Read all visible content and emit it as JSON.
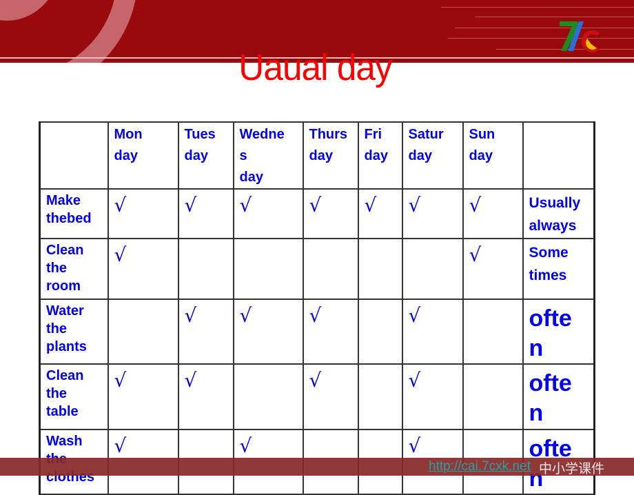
{
  "slide": {
    "title": "Uaual day",
    "logo": "7c-logo",
    "colors": {
      "banner": "#9a0a0c",
      "title": "#ff0000",
      "table_text": "#0000ee",
      "footer": "#872828"
    }
  },
  "table": {
    "headers": [
      "",
      "Mon day",
      "Tues day",
      "Wedne s day",
      "Thurs day",
      "Fri day",
      "Satur day",
      "Sun day",
      ""
    ],
    "header_lines": [
      [],
      [
        "Mon",
        "day"
      ],
      [
        "Tues",
        "day"
      ],
      [
        "Wedne",
        "s",
        "day"
      ],
      [
        "Thurs",
        "day"
      ],
      [
        "Fri",
        "day"
      ],
      [
        "Satur",
        "day"
      ],
      [
        "Sun",
        "day"
      ],
      []
    ],
    "check_mark": "√",
    "rows": [
      {
        "activity": [
          "Make",
          "thebed"
        ],
        "days": [
          true,
          true,
          true,
          true,
          true,
          true,
          true
        ],
        "frequency": [
          "Usually",
          "always"
        ],
        "freq_style": "normal"
      },
      {
        "activity": [
          "Clean",
          "the",
          "room"
        ],
        "days": [
          true,
          false,
          false,
          false,
          false,
          false,
          true
        ],
        "frequency": [
          "Some",
          "times"
        ],
        "freq_style": "normal"
      },
      {
        "activity": [
          "Water",
          "the",
          "plants"
        ],
        "days": [
          false,
          true,
          true,
          true,
          false,
          true,
          false
        ],
        "frequency": [
          "ofte",
          "n"
        ],
        "freq_style": "big"
      },
      {
        "activity": [
          "Clean",
          "the",
          "table"
        ],
        "days": [
          true,
          true,
          false,
          true,
          false,
          true,
          false
        ],
        "frequency": [
          "ofte",
          "n"
        ],
        "freq_style": "big"
      },
      {
        "activity": [
          "Wash",
          "the",
          "clothes"
        ],
        "days": [
          true,
          false,
          true,
          false,
          false,
          true,
          false
        ],
        "frequency": [
          "ofte",
          "n"
        ],
        "freq_style": "big"
      }
    ]
  },
  "footer": {
    "link": "http://cai.7cxk.net",
    "text": "中小学课件"
  }
}
